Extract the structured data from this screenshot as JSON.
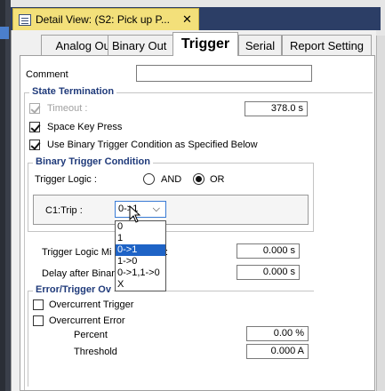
{
  "doc_tab": {
    "title": "Detail View: (S2: Pick up P...",
    "close": "✕"
  },
  "tabs": [
    {
      "label": "Analog Out"
    },
    {
      "label": "Binary Out"
    },
    {
      "label": "Trigger"
    },
    {
      "label": "Serial"
    },
    {
      "label": "Report Setting"
    }
  ],
  "comment": {
    "label": "Comment",
    "value": ""
  },
  "state_termination": {
    "title": "State Termination",
    "timeout": {
      "label": "Timeout :",
      "value": "378.0 s",
      "checked": true,
      "disabled": true
    },
    "space_key": {
      "label": "Space Key Press",
      "checked": true
    },
    "use_binary": {
      "label": "Use Binary Trigger Condition as Specified Below",
      "checked": true
    }
  },
  "binary_trigger": {
    "title": "Binary Trigger Condition",
    "logic_label": "Trigger Logic :",
    "and_label": "AND",
    "or_label": "OR",
    "selected": "OR",
    "c1_label": "C1:Trip :",
    "c1_value": "0->1"
  },
  "dropdown": {
    "options": [
      "0",
      "1",
      "0->1",
      "1->0",
      "0->1,1->0",
      "X"
    ],
    "selected_index": 2
  },
  "min_duration": {
    "label": "Trigger Logic Mi",
    "label_tail": ":",
    "value": "0.000 s"
  },
  "delay": {
    "label": "Delay after Binar",
    "value": "0.000 s"
  },
  "error_trigger": {
    "title": "Error/Trigger Ov",
    "overcurrent_trigger": {
      "label": "Overcurrent Trigger",
      "checked": false
    },
    "overcurrent_error": {
      "label": "Overcurrent Error",
      "checked": false
    },
    "percent": {
      "label": "Percent",
      "value": "0.00 %"
    },
    "threshold": {
      "label": "Threshold",
      "value": "0.000 A"
    }
  }
}
